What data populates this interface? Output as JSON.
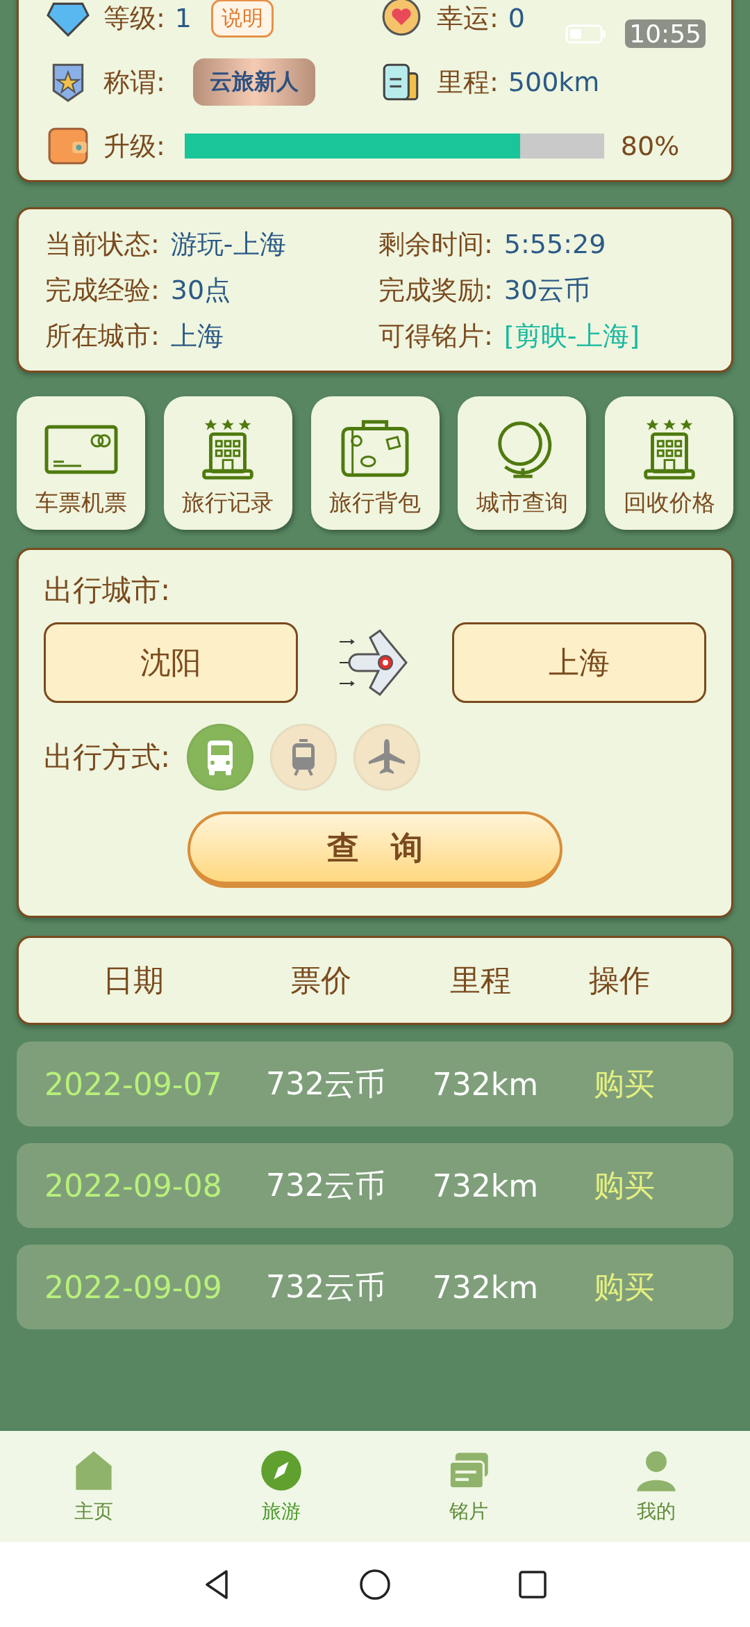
{
  "status_bar": {
    "time": "10:55"
  },
  "profile": {
    "level_label": "等级:",
    "level": "1",
    "explain_button": "说明",
    "luck_label": "幸运:",
    "luck": "0",
    "title_label": "称谓:",
    "title_badge": "云旅新人",
    "mileage_label": "里程:",
    "mileage": "500km",
    "upgrade_label": "升级:",
    "upgrade": {
      "level": 0.8,
      "reading": "80%"
    }
  },
  "trip": [
    {
      "label": "当前状态:",
      "value": "游玩-上海",
      "kind": "plain"
    },
    {
      "label": "剩余时间:",
      "value": "5:55:29",
      "kind": "plain"
    },
    {
      "label": "完成经验:",
      "value": "30点",
      "kind": "plain"
    },
    {
      "label": "完成奖励:",
      "value": "30云币",
      "kind": "plain"
    },
    {
      "label": "所在城市:",
      "value": "上海",
      "kind": "plain"
    },
    {
      "label": "可得铭片:",
      "value": "[剪映-上海]",
      "kind": "link"
    }
  ],
  "shortcuts": [
    {
      "label": "车票机票",
      "kind": "card"
    },
    {
      "label": "旅行记录",
      "kind": "hotel"
    },
    {
      "label": "旅行背包",
      "kind": "suitcase"
    },
    {
      "label": "城市查询",
      "kind": "globe"
    },
    {
      "label": "回收价格",
      "kind": "hotel"
    }
  ],
  "travel": {
    "city_label": "出行城市:",
    "from": "沈阳",
    "to": "上海",
    "mode_label": "出行方式:",
    "modes": [
      {
        "kind": "bus",
        "selected": true
      },
      {
        "kind": "train",
        "selected": false
      },
      {
        "kind": "plane",
        "selected": false
      }
    ],
    "search_button": "查　询"
  },
  "table": {
    "columns": [
      "日期",
      "票价",
      "里程",
      "操作"
    ],
    "rows": [
      {
        "date": "2022-09-07",
        "price": "732云币",
        "distance": "732km",
        "action": "购买"
      },
      {
        "date": "2022-09-08",
        "price": "732云币",
        "distance": "732km",
        "action": "购买"
      },
      {
        "date": "2022-09-09",
        "price": "732云币",
        "distance": "732km",
        "action": "购买"
      }
    ]
  },
  "nav": [
    {
      "label": "主页",
      "kind": "home",
      "selected": false
    },
    {
      "label": "旅游",
      "kind": "compass",
      "selected": true
    },
    {
      "label": "铭片",
      "kind": "cards",
      "selected": false
    },
    {
      "label": "我的",
      "kind": "person",
      "selected": false
    }
  ]
}
